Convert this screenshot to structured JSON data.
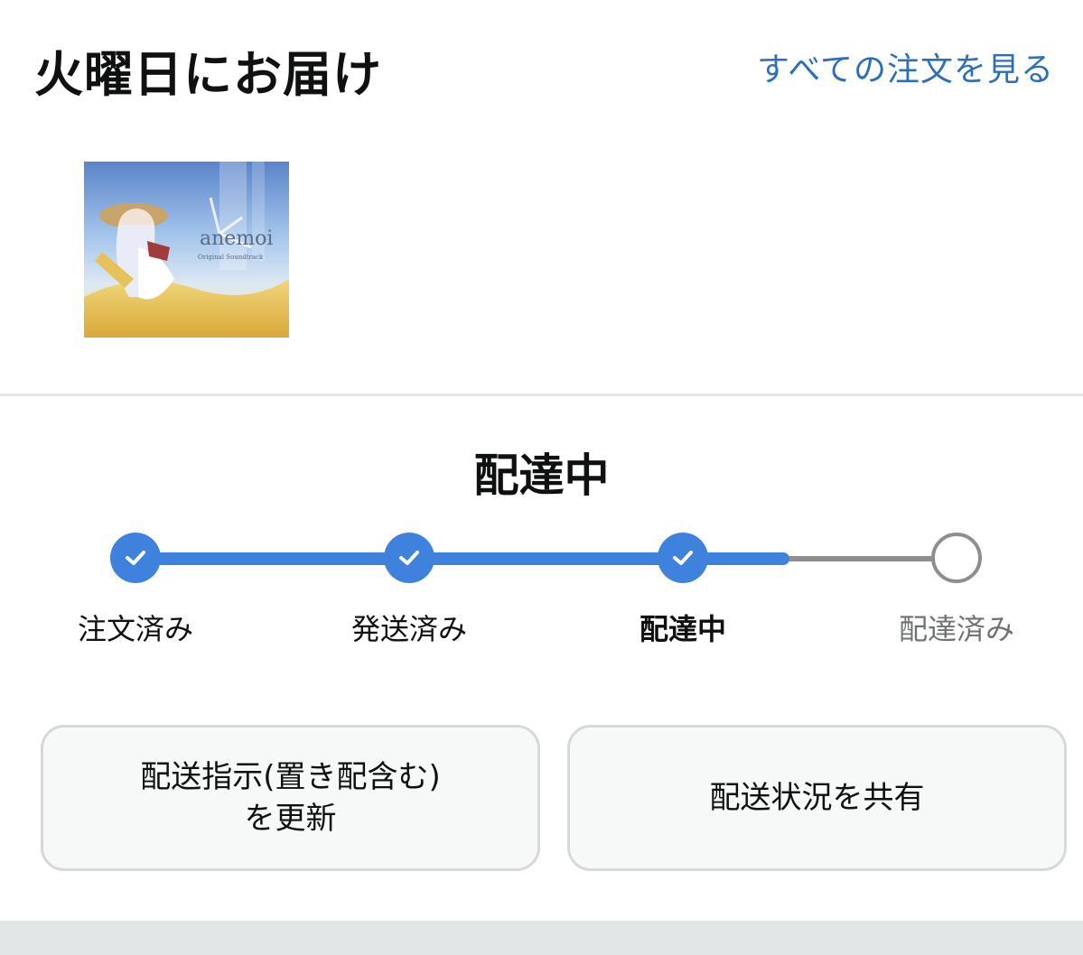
{
  "header": {
    "title": "火曜日にお届け",
    "all_orders_link": "すべての注文を見る"
  },
  "product": {
    "album_title": "anemoi",
    "album_subtitle": "Original Soundtrack"
  },
  "status": {
    "title": "配達中"
  },
  "tracker": {
    "steps": [
      {
        "label": "注文済み",
        "state": "done"
      },
      {
        "label": "発送済み",
        "state": "done"
      },
      {
        "label": "配達中",
        "state": "current"
      },
      {
        "label": "配達済み",
        "state": "pending"
      }
    ],
    "progress": 0.75,
    "colors": {
      "done": "#3f82de",
      "pending": "#8e8e8e"
    }
  },
  "actions": {
    "update_delivery_line1": "配送指示(置き配含む)",
    "update_delivery_line2": "を更新",
    "share_status": "配送状況を共有"
  }
}
